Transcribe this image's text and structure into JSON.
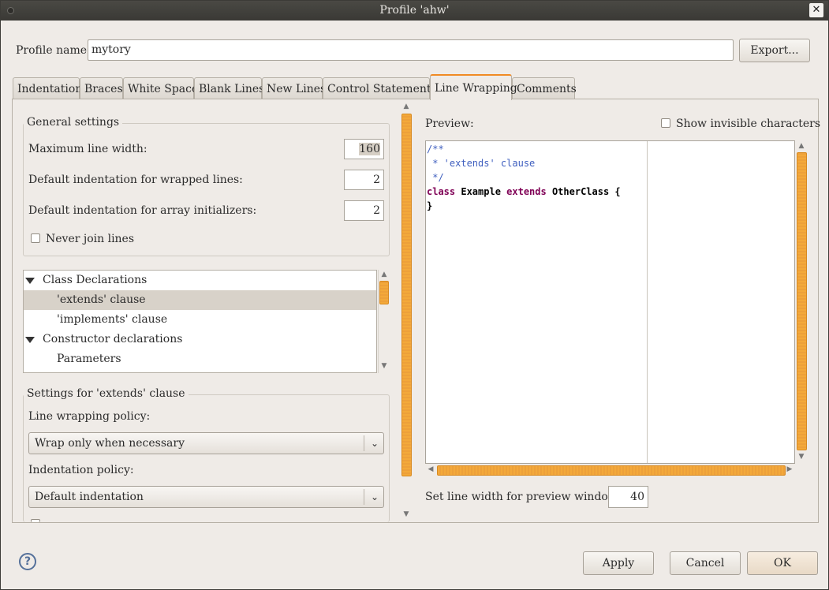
{
  "window": {
    "title": "Profile 'ahw'"
  },
  "profile": {
    "name_label": "Profile name:",
    "name_value": "mytory",
    "export_label": "Export..."
  },
  "tabs": [
    {
      "label": "Indentation"
    },
    {
      "label": "Braces"
    },
    {
      "label": "White Space"
    },
    {
      "label": "Blank Lines"
    },
    {
      "label": "New Lines"
    },
    {
      "label": "Control Statements"
    },
    {
      "label": "Line Wrapping",
      "active": true
    },
    {
      "label": "Comments"
    }
  ],
  "general": {
    "title": "General settings",
    "max_width_label": "Maximum line width:",
    "max_width_value": "160",
    "wrap_indent_label": "Default indentation for wrapped lines:",
    "wrap_indent_value": "2",
    "array_indent_label": "Default indentation for array initializers:",
    "array_indent_value": "2",
    "never_join_label": "Never join lines",
    "never_join_checked": false
  },
  "tree": {
    "items": [
      {
        "label": "Class Declarations",
        "expanded": true,
        "level": 0
      },
      {
        "label": "'extends' clause",
        "level": 1,
        "selected": true
      },
      {
        "label": "'implements' clause",
        "level": 1
      },
      {
        "label": "Constructor declarations",
        "expanded": true,
        "level": 0
      },
      {
        "label": "Parameters",
        "level": 1
      }
    ]
  },
  "settings": {
    "title": "Settings for 'extends' clause",
    "policy_label": "Line wrapping policy:",
    "policy_value": "Wrap only when necessary",
    "indent_label": "Indentation policy:",
    "indent_value": "Default indentation"
  },
  "preview": {
    "label": "Preview:",
    "show_invisible_label": "Show invisible characters",
    "show_invisible_checked": false,
    "code_lines": {
      "l1": "/**",
      "l2": " * 'extends' clause",
      "l3": " */",
      "l4_kw1": "class",
      "l4_name": " Example ",
      "l4_kw2": "extends",
      "l4_rest": " OtherClass {",
      "l5": "}"
    },
    "line_width_label": "Set line width for preview window:",
    "line_width_value": "40"
  },
  "footer": {
    "apply_label": "Apply",
    "cancel_label": "Cancel",
    "ok_label": "OK",
    "help_glyph": "?"
  },
  "colors": {
    "accent": "#f08a24",
    "keyword": "#7f0055",
    "comment": "#3f5fbf"
  }
}
